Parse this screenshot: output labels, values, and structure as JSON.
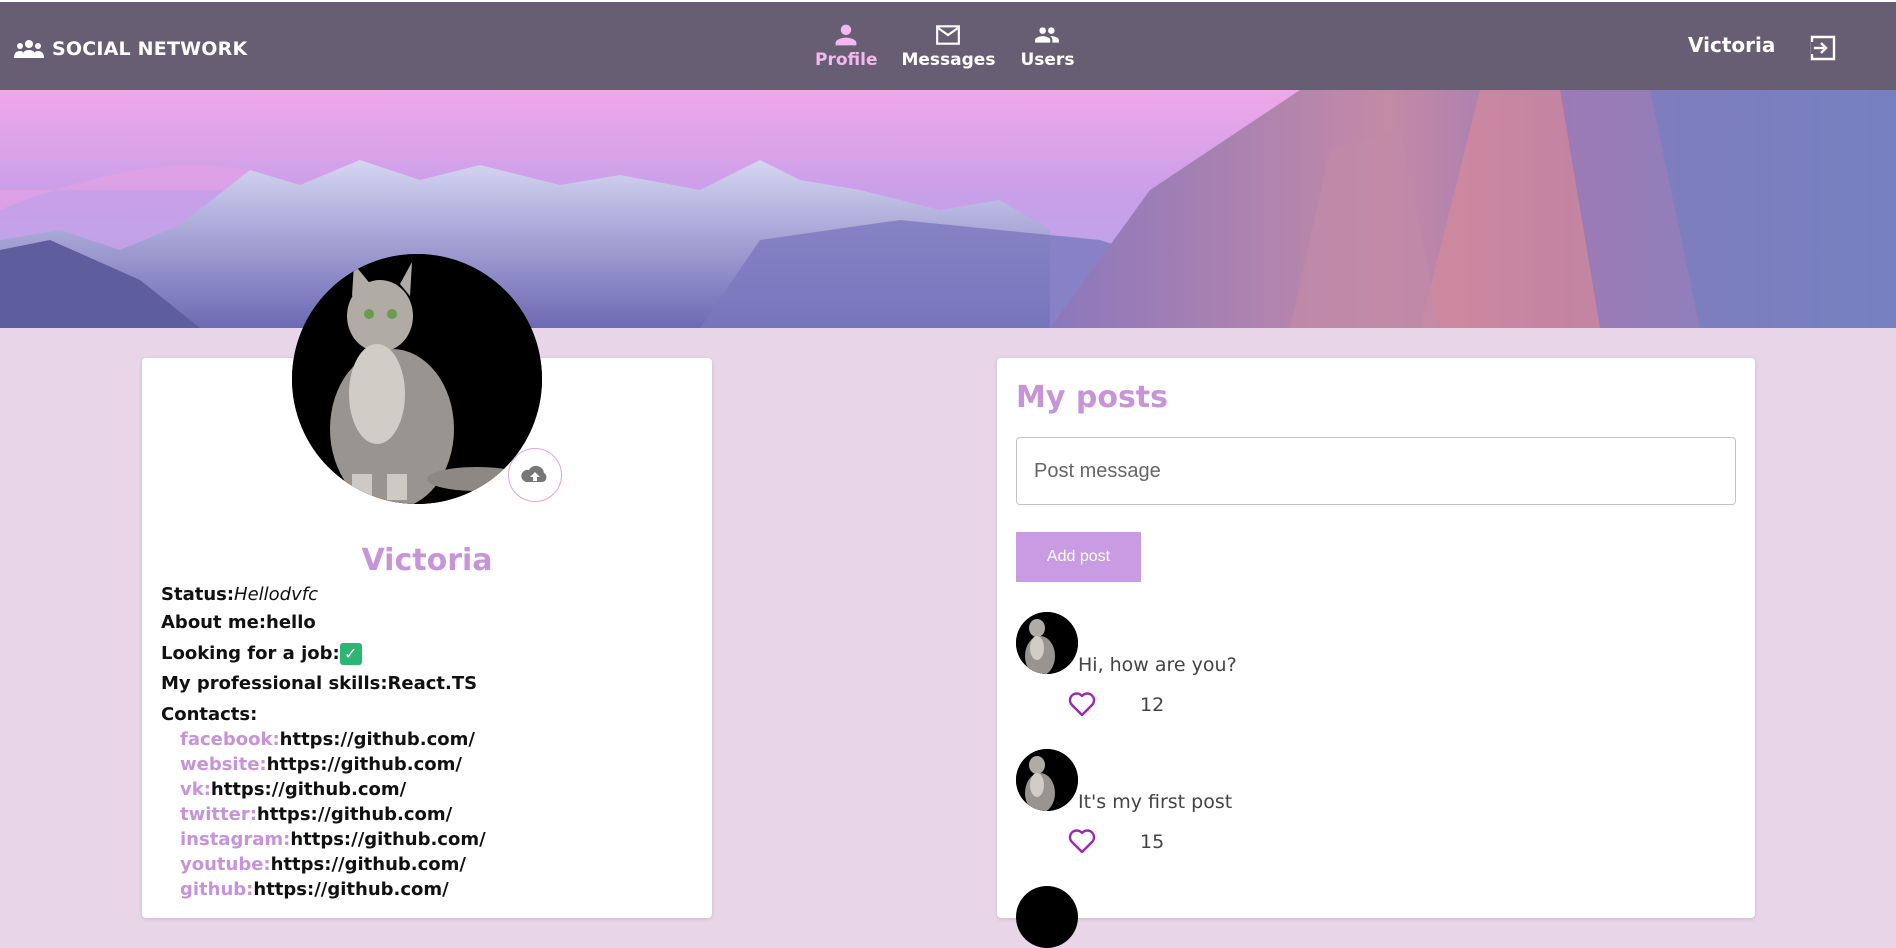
{
  "header": {
    "brand": "SOCIAL NETWORK",
    "nav": [
      {
        "label": "Profile",
        "active": true
      },
      {
        "label": "Messages",
        "active": false
      },
      {
        "label": "Users",
        "active": false
      }
    ],
    "user": "Victoria"
  },
  "profile": {
    "name": "Victoria",
    "status_label": "Status:",
    "status_value": "Hellodvfc",
    "about_label": "About me:",
    "about_value": "hello",
    "job_label": "Looking for a job:",
    "job_check": "✓",
    "skills_label": "My professional skills:",
    "skills_value": "React.TS",
    "contacts_label": "Contacts:",
    "contacts": [
      {
        "key": "facebook:",
        "value": "https://github.com/"
      },
      {
        "key": "website:",
        "value": "https://github.com/"
      },
      {
        "key": "vk:",
        "value": "https://github.com/"
      },
      {
        "key": "twitter:",
        "value": "https://github.com/"
      },
      {
        "key": "instagram:",
        "value": "https://github.com/"
      },
      {
        "key": "youtube:",
        "value": "https://github.com/"
      },
      {
        "key": "github:",
        "value": "https://github.com/"
      }
    ]
  },
  "posts": {
    "title": "My posts",
    "input_placeholder": "Post message",
    "add_button": "Add post",
    "items": [
      {
        "text": "Hi, how are you?",
        "likes": "12"
      },
      {
        "text": "It's my first post",
        "likes": "15"
      }
    ]
  },
  "colors": {
    "header_bg": "#685e73",
    "accent": "#c793d9",
    "page_bg": "#e8d5e7",
    "active_nav": "#f4b8f0"
  }
}
